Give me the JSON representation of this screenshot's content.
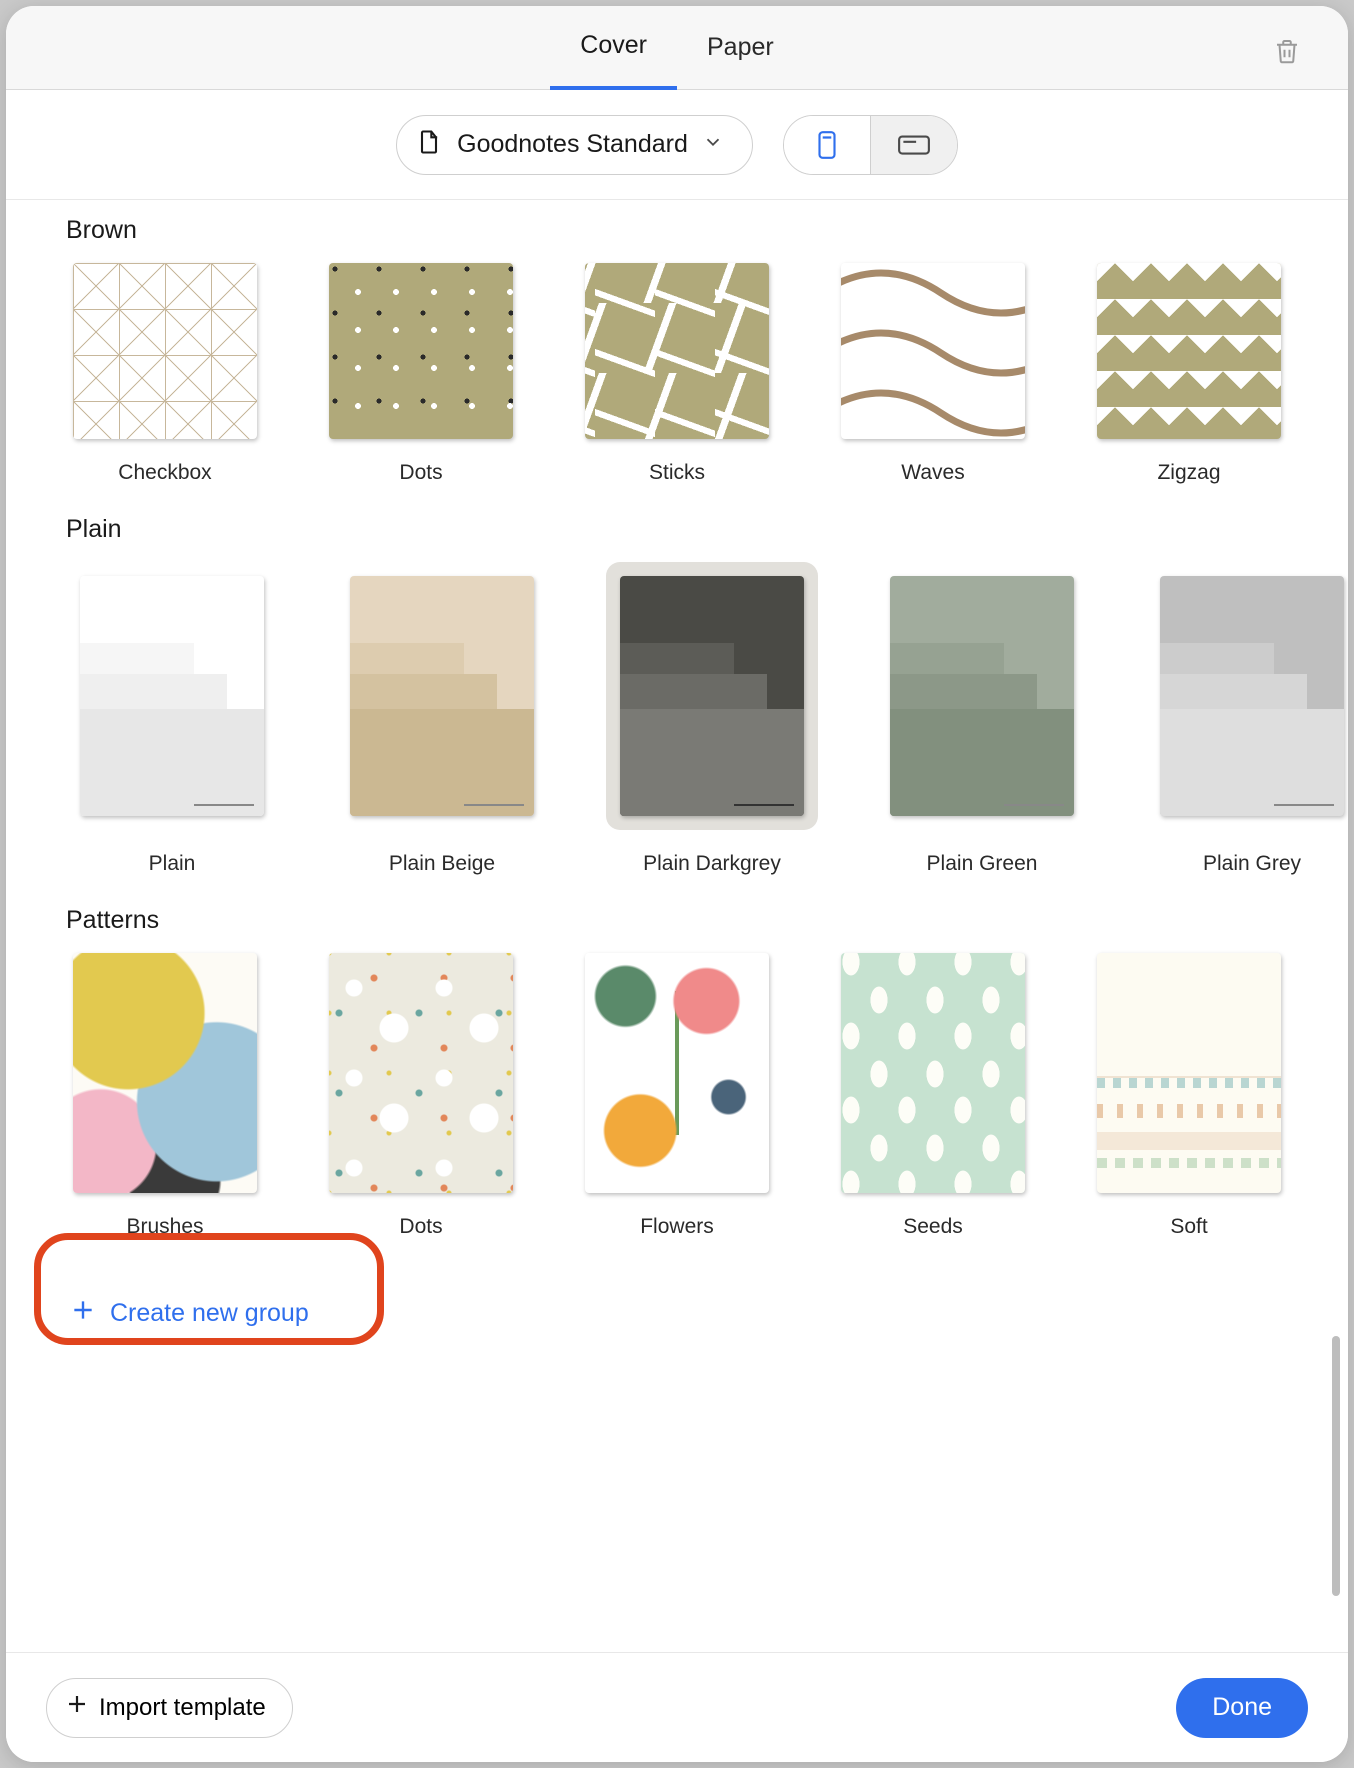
{
  "tabs": {
    "cover": "Cover",
    "paper": "Paper",
    "active": "cover"
  },
  "style_picker": "Goodnotes Standard",
  "sections": {
    "brown": {
      "title": "Brown",
      "items": [
        "Checkbox",
        "Dots",
        "Sticks",
        "Waves",
        "Zigzag"
      ]
    },
    "plain": {
      "title": "Plain",
      "items": [
        "Plain",
        "Plain Beige",
        "Plain Darkgrey",
        "Plain Green",
        "Plain Grey"
      ],
      "selected_index": 2
    },
    "patterns": {
      "title": "Patterns",
      "items": [
        "Brushes",
        "Dots",
        "Flowers",
        "Seeds",
        "Soft"
      ]
    }
  },
  "create_group": "Create new group",
  "footer": {
    "import": "Import template",
    "done": "Done"
  }
}
